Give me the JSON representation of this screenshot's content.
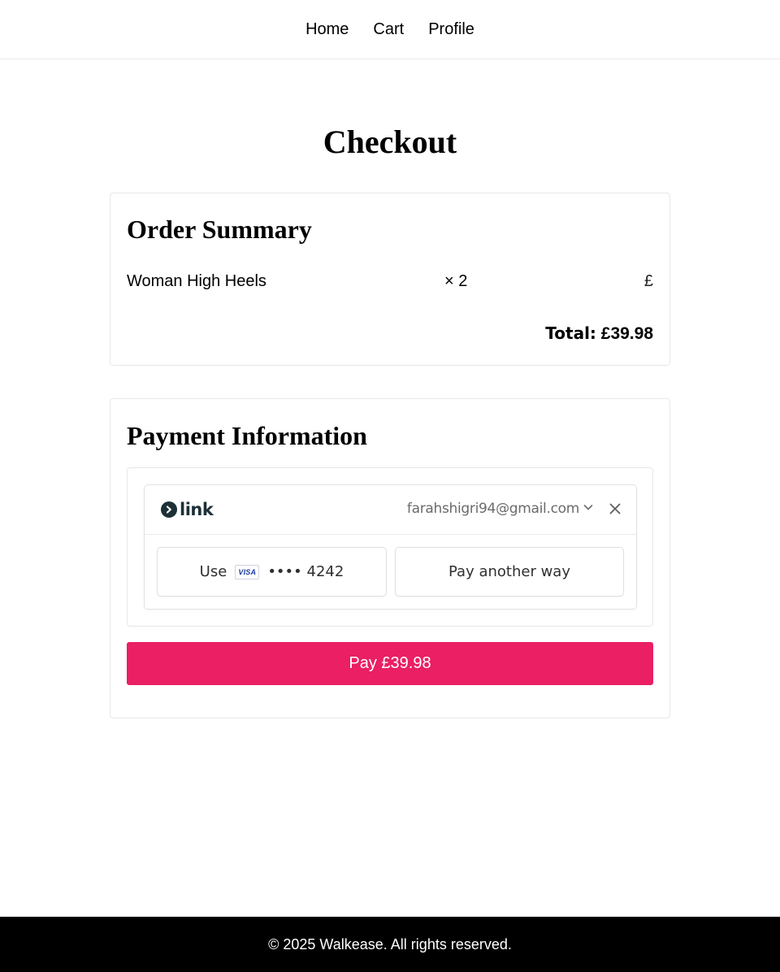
{
  "nav": {
    "items": [
      {
        "label": "Home"
      },
      {
        "label": "Cart"
      },
      {
        "label": "Profile"
      }
    ]
  },
  "page": {
    "title": "Checkout"
  },
  "order_summary": {
    "heading": "Order Summary",
    "items": [
      {
        "name": "Woman High Heels",
        "quantity": "× 2",
        "price": "£"
      }
    ],
    "total_label": "Total:",
    "total_value": "£39.98"
  },
  "payment": {
    "heading": "Payment Information",
    "link": {
      "logo_text": "link",
      "email": "farahshigri94@gmail.com",
      "use_label": "Use",
      "card_brand": "VISA",
      "card_masked": "•••• 4242",
      "pay_another_label": "Pay another way"
    },
    "pay_button_label": "Pay £39.98"
  },
  "footer": {
    "text": "© 2025 Walkease. All rights reserved."
  },
  "colors": {
    "accent": "#ea1f64",
    "link_brand": "#1d3038",
    "footer_bg": "#000000"
  },
  "icons": {
    "link_logo": "link-logo-icon",
    "email_dropdown": "chevron-down-icon",
    "close": "close-icon",
    "card": "visa-icon"
  }
}
